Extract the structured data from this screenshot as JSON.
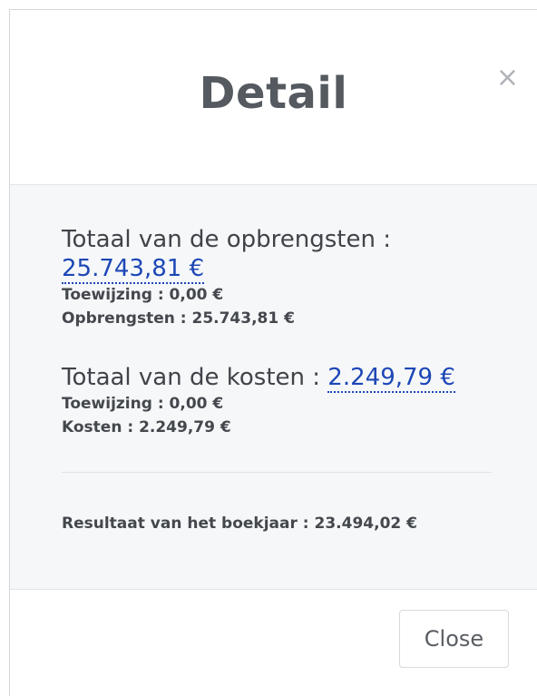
{
  "modal": {
    "title": "Detail",
    "close_icon": "×",
    "close_button_label": "Close"
  },
  "revenue": {
    "heading_label": "Totaal van de opbrengsten :",
    "total": "25.743,81 €",
    "allocation_line": "Toewijzing : 0,00 €",
    "detail_line": "Opbrengsten : 25.743,81 €"
  },
  "costs": {
    "heading_label": "Totaal van de kosten :",
    "total": "2.249,79 €",
    "allocation_line": "Toewijzing : 0,00 €",
    "detail_line": "Kosten : 2.249,79 €"
  },
  "result_line": "Resultaat van het boekjaar : 23.494,02 €",
  "colors": {
    "link": "#1d47b6",
    "body_background": "#f5f7f9"
  }
}
